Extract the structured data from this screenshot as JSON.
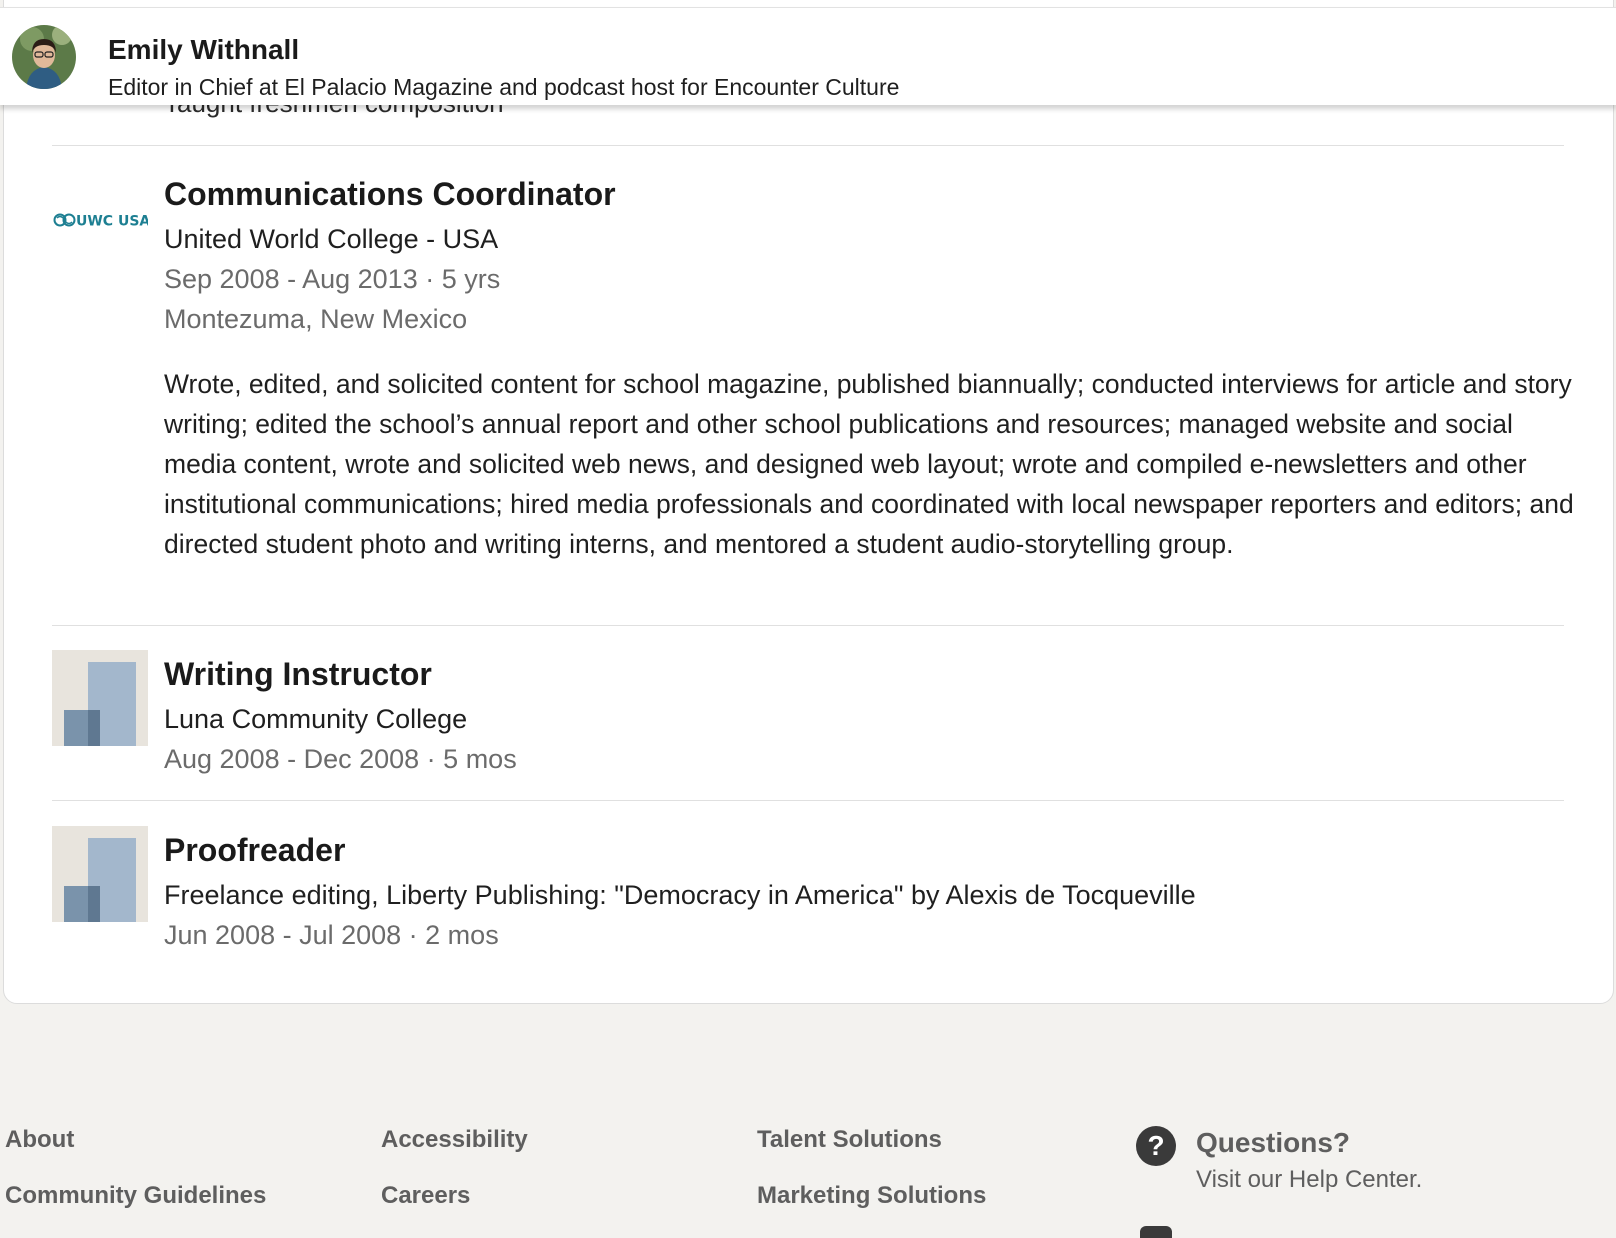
{
  "sticky_header": {
    "name": "Emily Withnall",
    "headline": "Editor in Chief at El Palacio Magazine and podcast host for Encounter Culture"
  },
  "previous_entry_cutoff": "Taught freshmen composition",
  "experience": [
    {
      "logo": "UWC USA",
      "title": "Communications Coordinator",
      "company": "United World College - USA",
      "dates": "Sep 2008 - Aug 2013 · 5 yrs",
      "location": "Montezuma, New Mexico",
      "description": "Wrote, edited, and solicited content for school magazine, published biannually; conducted interviews for article and story writing; edited the school’s annual report and other school publications and resources; managed website and social media content, wrote and solicited web news, and designed web layout; wrote and compiled e-newsletters and other institutional communications; hired media professionals and coordinated with local newspaper reporters and editors; and directed student photo and writing interns, and mentored a student audio-storytelling group."
    },
    {
      "title": "Writing Instructor",
      "company": "Luna Community College",
      "dates": "Aug 2008 - Dec 2008 · 5 mos"
    },
    {
      "title": "Proofreader",
      "company": "Freelance editing, Liberty Publishing: \"Democracy in America\" by Alexis de Tocqueville",
      "dates": "Jun 2008 - Jul 2008 · 2 mos"
    }
  ],
  "footer": {
    "links": [
      "About",
      "Community Guidelines",
      "Accessibility",
      "Careers",
      "Talent Solutions",
      "Marketing Solutions"
    ],
    "help_title": "Questions?",
    "help_subtitle": "Visit our Help Center.",
    "help_icon": "question-circle-icon"
  }
}
